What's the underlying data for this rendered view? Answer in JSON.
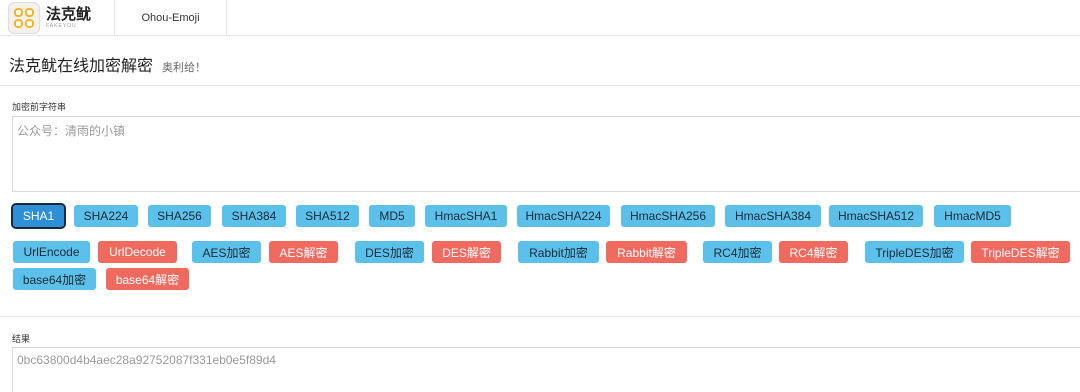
{
  "header": {
    "brand_name": "法克鱿",
    "brand_sub": "FAKEYOU",
    "tab_label": "Ohou-Emoji"
  },
  "page": {
    "title": "法克鱿在线加密解密",
    "subtitle": "奥利给！"
  },
  "input": {
    "label": "加密前字符串",
    "placeholder": "公众号：清雨的小镇",
    "value": ""
  },
  "hash_buttons": [
    "SHA1",
    "SHA224",
    "SHA256",
    "SHA384",
    "SHA512",
    "MD5",
    "HmacSHA1",
    "HmacSHA224",
    "HmacSHA256",
    "HmacSHA384",
    "HmacSHA512",
    "HmacMD5"
  ],
  "codec_buttons": [
    "UrlEncode",
    "UrlDecode",
    "AES加密",
    "AES解密",
    "DES加密",
    "DES解密",
    "Rabbit加密",
    "Rabbit解密",
    "RC4加密",
    "RC4解密",
    "TripleDES加密",
    "TripleDES解密",
    "base64加密",
    "base64解密"
  ],
  "output": {
    "label": "结果",
    "value": "0bc63800d4b4aec28a92752087f331eb0e5f89d4"
  },
  "colors": {
    "blue_button": "#5bc0ea",
    "red_button": "#f06a60",
    "active_button": "#2d8fd6"
  }
}
